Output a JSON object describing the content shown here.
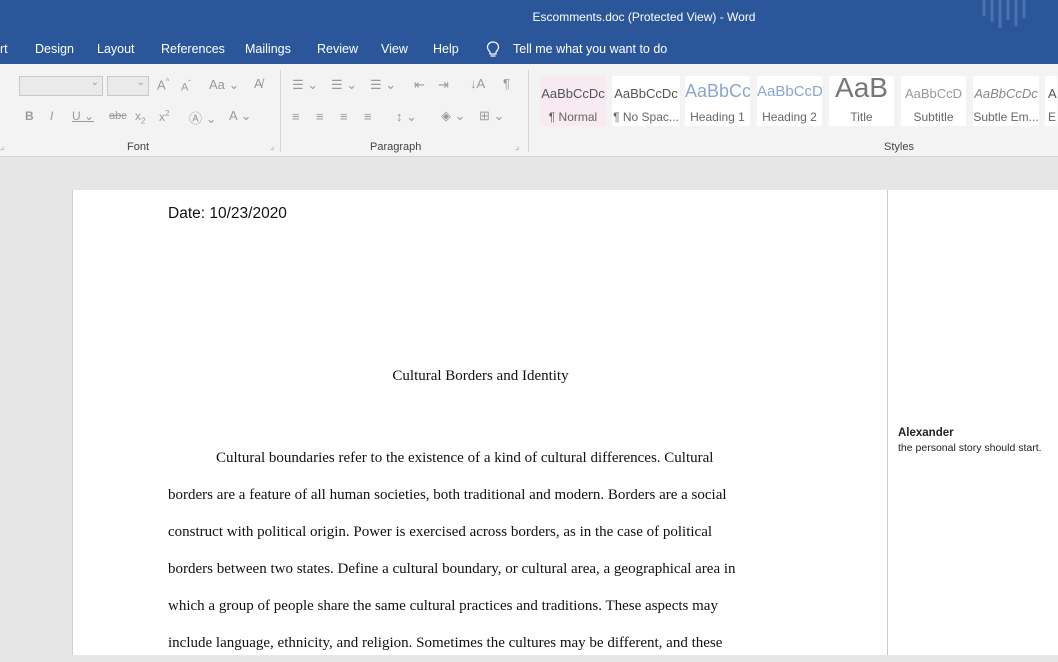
{
  "window": {
    "title": "Escomments.doc (Protected View)  -  Word"
  },
  "menu": {
    "partial_tab": "rt",
    "tabs": [
      "Design",
      "Layout",
      "References",
      "Mailings",
      "Review",
      "View",
      "Help"
    ],
    "tell_me": "Tell me what you want to do"
  },
  "ribbon": {
    "font_group": "Font",
    "paragraph_group": "Paragraph",
    "styles_group": "Styles",
    "styles": [
      {
        "preview": "AaBbCcDc",
        "name": "¶ Normal"
      },
      {
        "preview": "AaBbCcDc",
        "name": "¶ No Spac..."
      },
      {
        "preview": "AaBbCc",
        "name": "Heading 1"
      },
      {
        "preview": "AaBbCcD",
        "name": "Heading 2"
      },
      {
        "preview": "AaB",
        "name": "Title"
      },
      {
        "preview": "AaBbCcD",
        "name": "Subtitle"
      },
      {
        "preview": "AaBbCcDc",
        "name": "Subtle Em..."
      },
      {
        "preview": "A",
        "name": "E"
      }
    ]
  },
  "document": {
    "date_line": "Date: 10/23/2020",
    "heading": "Cultural Borders and Identity",
    "paragraph_lines": [
      "Cultural boundaries refer to the existence of a kind of cultural differences. Cultural",
      "borders are a feature of all human societies, both traditional and modern. Borders are a social",
      "construct with political origin. Power is exercised across borders, as in the case of political",
      "borders between two states. Define a cultural boundary, or cultural area, a geographical area in",
      "which a group of people share the same cultural practices and traditions. These aspects may",
      "include language, ethnicity, and religion. Sometimes the cultures may be different, and these"
    ]
  },
  "comment": {
    "author": "Alexander",
    "text": "the personal story should start."
  },
  "colors": {
    "titlebar": "#2b579a",
    "ribbon": "#f3f3f3",
    "canvas": "#e6e6e6"
  }
}
